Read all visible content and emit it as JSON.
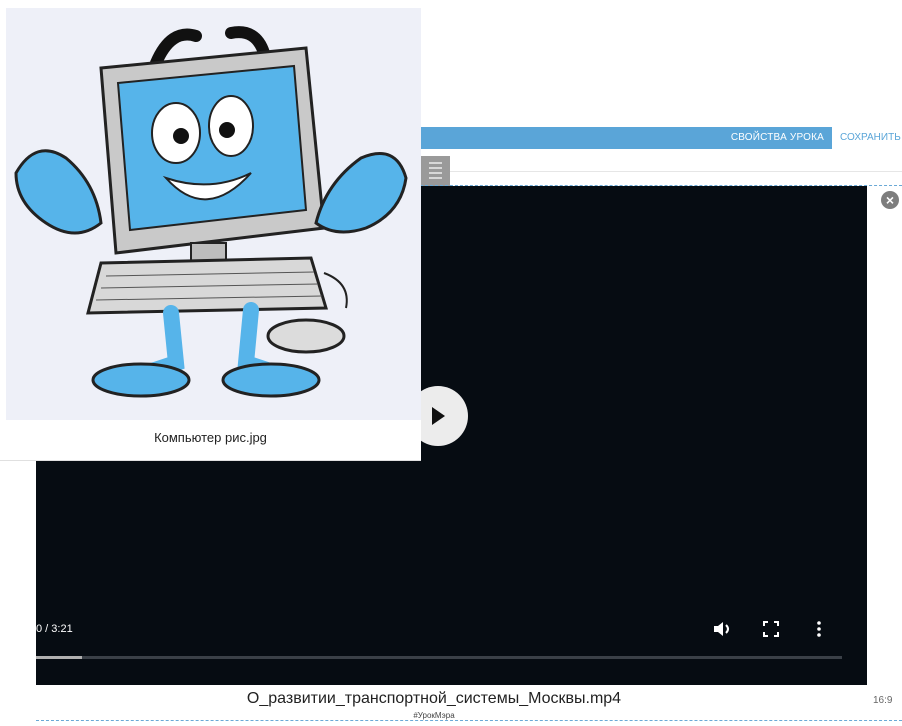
{
  "header": {
    "lesson_properties_label": "СВОЙСТВА УРОКА",
    "save_label": "СОХРАНИТЬ"
  },
  "video": {
    "time": "0 / 3:21",
    "progress_fraction": 0.057,
    "filename": "О_развитии_транспортной_системы_Москвы.mp4",
    "aspect_ratio": "16:9",
    "hashtag": "#УрокМэра"
  },
  "image": {
    "caption": "Компьютер рис.jpg",
    "icon": "cartoon-computer-illustration"
  },
  "icons": {
    "close": "close-icon",
    "play": "play-icon",
    "volume": "volume-icon",
    "fullscreen": "fullscreen-icon",
    "more": "more-vert-icon",
    "drag": "drag-handle-icon"
  },
  "colors": {
    "accent": "#5aa5d8",
    "video_bg": "#060c12"
  }
}
